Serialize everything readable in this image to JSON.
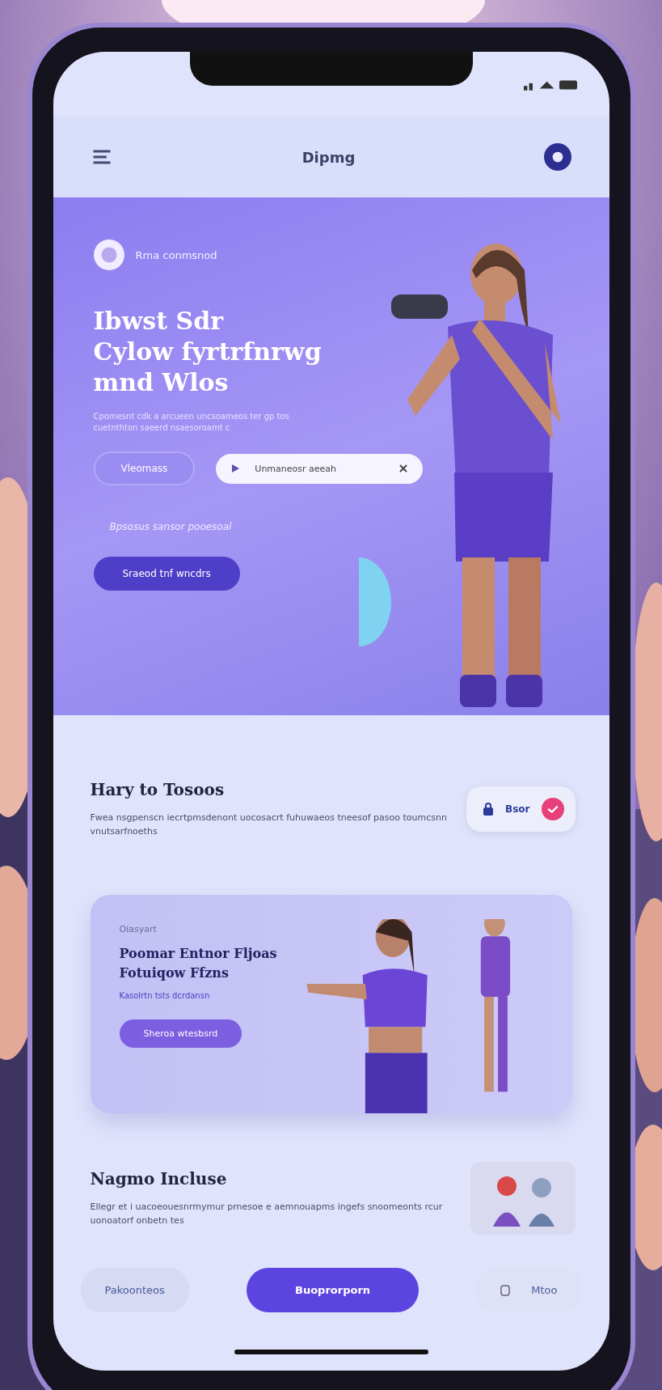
{
  "header": {
    "title": "Dipmg"
  },
  "hero": {
    "brand": "Rma conmsnod",
    "heading_lines": [
      "Ibwst Sdr",
      "Cylow fyrtrfnrwg",
      "mnd Wlos"
    ],
    "description": "Cpomesnt cdk a arcueen uncsoameos ter gp tos cuetnthton saeerd nsaesoroamt c",
    "pill_button": "Vleomass",
    "search_pill": "Unmaneosr aeeah",
    "caption": "Bpsosus sansor pooesoal",
    "cta": "Sraeod tnf wncdrs"
  },
  "section": {
    "heading": "Hary to Tosoos",
    "text": "Fwea nsgpenscn iecrtpmsdenont uocosacrt fuhuwaeos tneesof pasoo toumcsnn vnutsarfnoeths",
    "chip": "Bsor"
  },
  "card": {
    "eyebrow": "Oiasyart",
    "title_lines": [
      "Poomar Entnor Fljoas",
      "Fotuiqow Ffzns"
    ],
    "subtitle": "Kasolrtn tsts dcrdansn",
    "button": "Sheroa wtesbsrd"
  },
  "section2": {
    "heading": "Nagmo Incluse",
    "text": "Ellegr et i uacoeouesnrmymur prnesoe e aemnouapms ingefs snoomeonts rcur uonoatorf onbetn tes"
  },
  "bottom_bar": [
    {
      "kind": "soft",
      "label": "Pakoonteos"
    },
    {
      "kind": "primary",
      "label": "Buoprorporn"
    },
    {
      "kind": "icon",
      "label": "Mtoo"
    }
  ]
}
